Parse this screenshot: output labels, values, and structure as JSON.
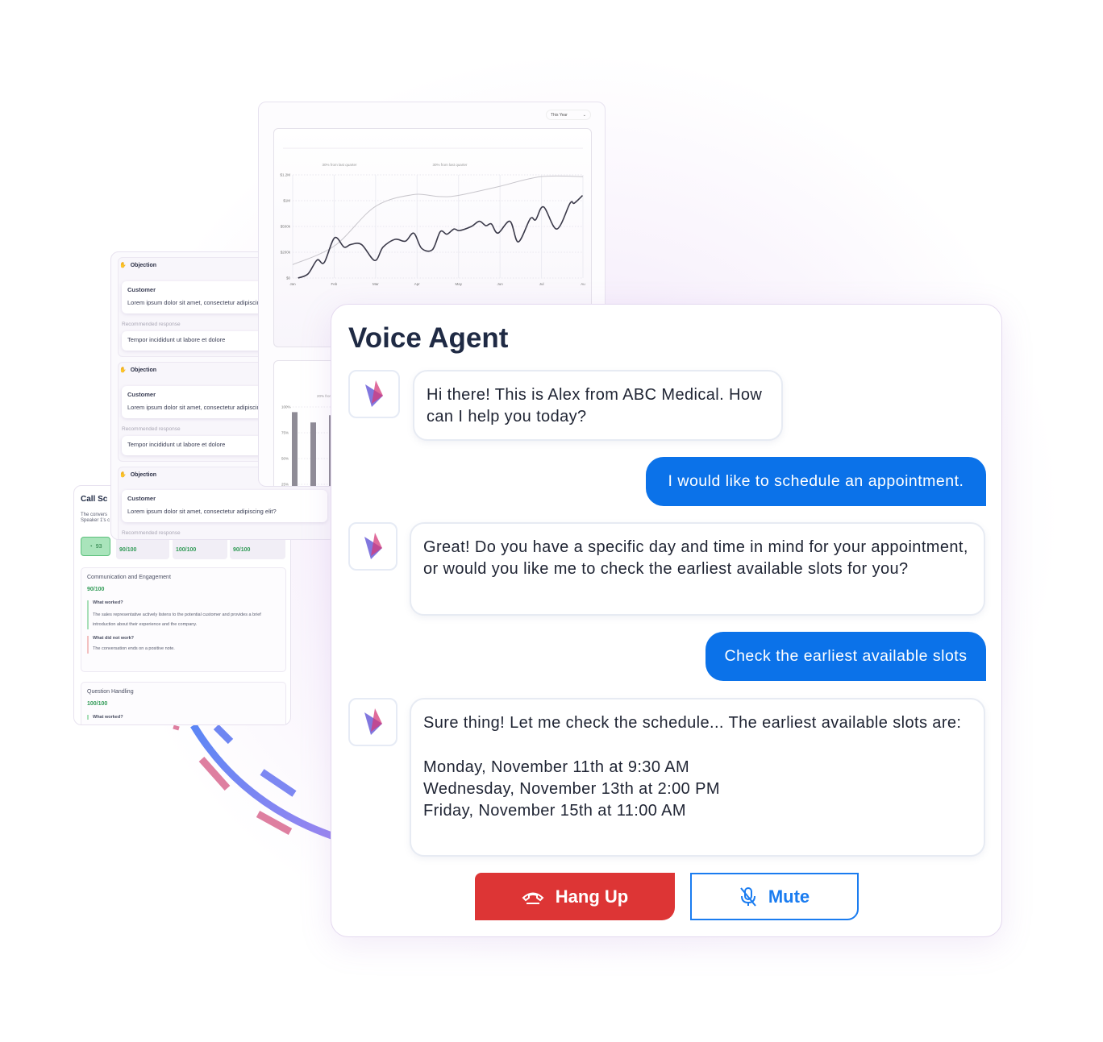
{
  "chart_panel": {
    "dropdown_value": "This Year",
    "chart_data": {
      "type": "line",
      "x_ticks": [
        "Jan",
        "Feb",
        "Mar",
        "Apr",
        "May",
        "Jun",
        "Jul",
        "Au"
      ],
      "y_ticks": [
        "$0",
        "$200k",
        "$500k",
        "$1M",
        "$1.2M"
      ],
      "y_tick_values_k": [
        0,
        200,
        500,
        1000,
        1200
      ],
      "annotations": [
        "30% from last quarter",
        "30% from last quarter"
      ],
      "grid": true,
      "series": [
        {
          "color": "#c8c6cc",
          "x": [
            0,
            1.01,
            1.98,
            2.89,
            3.53,
            3.98,
            4.95,
            5.98,
            7
          ],
          "y": [
            104,
            275,
            880,
            1046,
            1032,
            1040,
            1108,
            1186,
            1186
          ]
        },
        {
          "color": "#3b3a4a",
          "x": [
            0.13,
            0.37,
            0.59,
            0.76,
            1.01,
            1.24,
            1.4,
            1.66,
            1.98,
            2.18,
            2.47,
            2.72,
            2.92,
            3.11,
            3.37,
            3.56,
            3.72,
            3.89,
            4.02,
            4.31,
            4.5,
            4.66,
            4.79,
            4.95,
            5.24,
            5.44,
            5.73,
            5.86,
            6.05,
            6.37,
            6.69,
            6.79,
            6.99
          ],
          "y": [
            0,
            32,
            140,
            120,
            368,
            260,
            290,
            290,
            136,
            260,
            350,
            329,
            422,
            245,
            230,
            440,
            410,
            470,
            452,
            500,
            600,
            515,
            550,
            422,
            600,
            320,
            650,
            630,
            880,
            470,
            950,
            950,
            1040
          ]
        }
      ]
    },
    "bar_chart": {
      "type": "bar",
      "annotation": "20% from last",
      "y_ticks": [
        "100%",
        "75%",
        "50%",
        "25%"
      ],
      "values": [
        95,
        85,
        92
      ],
      "color": "#8f8c96"
    }
  },
  "objections": {
    "items": [
      {
        "header": "Objection",
        "speaker": "Customer",
        "text": "Lorem ipsum dolor sit amet, consectetur adipiscing elit?",
        "rec_label": "Recommended response",
        "response": "Tempor incididunt ut labore et dolore"
      },
      {
        "header": "Objection",
        "speaker": "Customer",
        "text": "Lorem ipsum dolor sit amet, consectetur adipiscing elit?",
        "rec_label": "Recommended response",
        "response": "Tempor incididunt ut labore et dolore"
      },
      {
        "header": "Objection",
        "speaker": "Customer",
        "text": "Lorem ipsum dolor sit amet, consectetur adipiscing elit?",
        "rec_label": "Recommended response"
      }
    ]
  },
  "call_score": {
    "title": "Call Sc",
    "desc_line1": "The convers",
    "desc_line2": "Speaker 1's c",
    "overall": "93",
    "scores": [
      "90/100",
      "100/100",
      "90/100"
    ],
    "sections": [
      {
        "title": "Communication and Engagement",
        "score": "90/100",
        "worked_label": "What worked?",
        "worked_text": "The sales representative actively listens to the potential customer and provides a brief introduction about their experience and the company.",
        "not_worked_label": "What did not work?",
        "not_worked_text": "The conversation ends on a positive note."
      },
      {
        "title": "Question Handling",
        "score": "100/100",
        "worked_label": "What worked?"
      }
    ]
  },
  "voice_agent": {
    "title": "Voice Agent",
    "messages": [
      {
        "role": "agent",
        "text": "Hi there! This is Alex from ABC Medical. How can I help you today?"
      },
      {
        "role": "user",
        "text": "I would like to schedule an appointment."
      },
      {
        "role": "agent",
        "text": "Great! Do you have a specific day and time in mind for your appointment, or would you like me to check the earliest available slots for you?"
      },
      {
        "role": "user",
        "text": "Check the earliest available slots"
      },
      {
        "role": "agent",
        "text": "Sure thing! Let me check the schedule... The earliest available slots are:",
        "slots": [
          "Monday, November 11th at 9:30 AM",
          "Wednesday, November 13th at 2:00 PM",
          "Friday, November 15th at 11:00 AM"
        ]
      }
    ],
    "hang_up_label": "Hang Up",
    "mute_label": "Mute",
    "colors": {
      "user_bubble": "#0b72e9",
      "hang_up": "#dd3535",
      "mute": "#1a7cf0"
    }
  }
}
